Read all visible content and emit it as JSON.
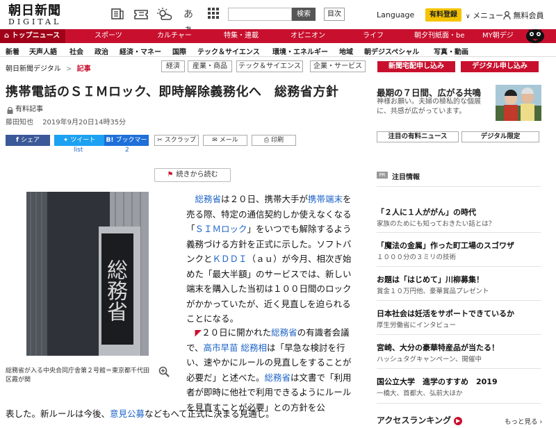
{
  "header": {
    "logo_main": "朝日新聞",
    "logo_sub": "DIGITAL",
    "search_button": "検索",
    "search_placeholder": "",
    "toc_button": "目次",
    "language": "Language",
    "paid_register": "有料登録",
    "menu": "メニュー",
    "member": "無料会員",
    "icons": [
      "newspaper-icon",
      "ticket-icon",
      "weather-icon",
      "hiragana-icon",
      "grid-icon",
      "search-icon",
      "user-icon"
    ]
  },
  "rednav": {
    "items": [
      "トップニュース",
      "スポーツ",
      "カルチャー",
      "特集・連載",
      "オピニオン",
      "ライフ",
      "朝夕刊紙面・be",
      "MY朝デジ"
    ]
  },
  "subnav": {
    "items": [
      "新着",
      "天声人語",
      "社会",
      "政治",
      "経済・マネー",
      "国際",
      "テック＆サイエンス",
      "環境・エネルギー",
      "地域",
      "朝デジスペシャル",
      "写真・動画"
    ]
  },
  "breadcrumb": {
    "home": "朝日新聞デジタル",
    "sep": ">",
    "current": "記事"
  },
  "tags": [
    "経済",
    "産業・商品",
    "テック＆サイエンス",
    "企業・サービス"
  ],
  "article": {
    "headline": "携帯電話のＳＩＭロック、即時解除義務化へ　総務省方針",
    "paid_label": "有料記事",
    "author": "藤田知也",
    "date": "2019年9月20日14時35分",
    "share": {
      "facebook": "シェア",
      "twitter": "ツイート",
      "twitter_sub": "list",
      "bookmark": "ブックマーク",
      "bookmark_count": "2",
      "scrap": "スクラップ",
      "mail": "メール",
      "print": "印刷"
    },
    "continue": "続きから読む",
    "photo_text": "総務省",
    "caption": "総務省が入る中央合同庁舎第２号館＝東京都千代田区霞が関",
    "p1": [
      "総務省",
      "は２０日、携帯大手が",
      "携帯端末",
      "を売る際、特定の通信契約しか使えなくなる「",
      "ＳＩＭロック",
      "」をいつでも解除するよう義務づける方針を正式に示した。ソフトバンクと",
      "ＫＤＤＩ",
      "（ａｕ）が今月、相次ぎ始めた「最大半額」のサービスでは、新しい端末を購入した当初は１００日間のロックがかかっていたが、近く見直しを迫られることになる。"
    ],
    "p2": [
      "２０日に開かれた",
      "総務省",
      "の有識者会議で、",
      "高市早苗",
      "総務相",
      "は「早急な検討を行い、速やかにルールの見直しをすることが必要だ」と述べた。",
      "総務省",
      "は文書で「利用者が即時に他社で利用できるようにルールを見直すことが必要」との方針を公"
    ],
    "last_line": [
      "表した。新ルールは今後、",
      "意見公募",
      "などもへて正式に決まる見通し。"
    ]
  },
  "sidebar": {
    "promo_delivery": "新聞宅配申し込み",
    "promo_digital": "デジタル申し込み",
    "feature_title": "最期の７日間、広がる共鳴",
    "feature_text": "神様お願い。夫婦の極私的な個展に、共感が広がっています。",
    "btn_paid_news": "注目の有料ニュース",
    "btn_digital": "デジタル限定",
    "pr_badge": "PR",
    "attention": "注目情報",
    "items": [
      {
        "title": "「２人に１人ががん」の時代",
        "sub": "家族のためにも知っておきたい話とは？"
      },
      {
        "title": "「魔法の金属」作った町工場のスゴワザ",
        "sub": "１０００分の３ミリの技術"
      },
      {
        "title": "お題は「はじめて」川柳募集！",
        "sub": "賞金１０万円他、豪華賞品プレゼント"
      },
      {
        "title": "日本社会は妊活をサポートできているか",
        "sub": "厚生労働省にインタビュー"
      },
      {
        "title": "宮崎、大分の豪華特産品が当たる！",
        "sub": "ハッシュタグキャンペーン、開催中"
      },
      {
        "title": "国公立大学　進学のすすめ　2019",
        "sub": "一橋大、首都大、弘前大ほか"
      }
    ],
    "ranking_title": "アクセスランキング",
    "ranking_more": "もっと見る"
  },
  "colors": {
    "brand_red": "#c8102e",
    "link_blue": "#1d64c7",
    "paid_yellow": "#f4c400"
  }
}
